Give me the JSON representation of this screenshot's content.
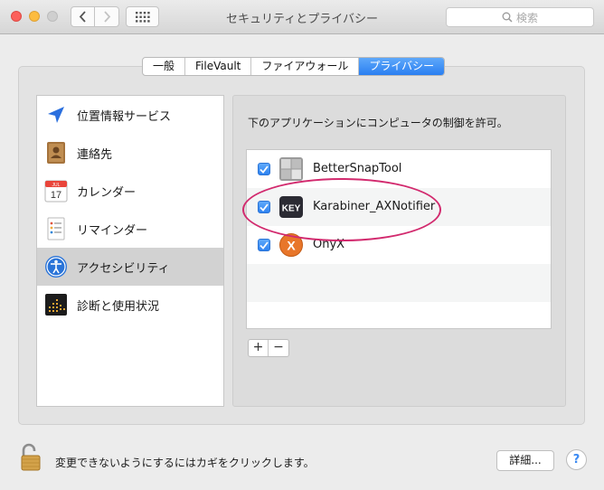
{
  "window": {
    "title": "セキュリティとプライバシー",
    "search_placeholder": "検索"
  },
  "tabs": [
    {
      "label": "一般",
      "active": false
    },
    {
      "label": "FileVault",
      "active": false
    },
    {
      "label": "ファイアウォール",
      "active": false
    },
    {
      "label": "プライバシー",
      "active": true
    }
  ],
  "sidebar": {
    "items": [
      {
        "label": "位置情報サービス",
        "icon": "location-arrow-icon",
        "selected": false
      },
      {
        "label": "連絡先",
        "icon": "contacts-book-icon",
        "selected": false
      },
      {
        "label": "カレンダー",
        "icon": "calendar-icon",
        "selected": false,
        "icon_text": "JUL",
        "icon_day": "17"
      },
      {
        "label": "リマインダー",
        "icon": "reminders-icon",
        "selected": false
      },
      {
        "label": "アクセシビリティ",
        "icon": "accessibility-icon",
        "selected": true
      },
      {
        "label": "診断と使用状況",
        "icon": "diagnostics-icon",
        "selected": false
      }
    ]
  },
  "panel": {
    "instruction": "下のアプリケーションにコンピュータの制御を許可。",
    "apps": [
      {
        "name": "BetterSnapTool",
        "checked": true,
        "icon": "bettersnaptool-icon"
      },
      {
        "name": "Karabiner_AXNotifier",
        "checked": true,
        "icon": "karabiner-key-icon",
        "icon_text": "KEY",
        "highlighted": true
      },
      {
        "name": "OnyX",
        "checked": true,
        "icon": "onyx-icon",
        "icon_text": "X"
      }
    ],
    "add_label": "+",
    "remove_label": "−"
  },
  "footer": {
    "lock_text": "変更できないようにするにはカギをクリックします。",
    "details_label": "詳細...",
    "help_label": "?"
  },
  "colors": {
    "accent": "#2a7ff1",
    "highlight_ring": "#d22a6e",
    "selection": "#d2d2d2"
  }
}
